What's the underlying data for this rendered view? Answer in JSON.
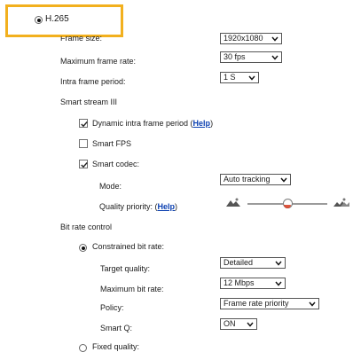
{
  "codec": {
    "h265_label": "H.265",
    "frame_size_label": "Frame size:",
    "frame_size_value": "1920x1080",
    "max_frame_rate_label": "Maximum frame rate:",
    "max_frame_rate_value": "30 fps",
    "intra_frame_period_label": "Intra frame period:",
    "intra_frame_period_value": "1 S"
  },
  "smart_stream": {
    "title": "Smart stream III",
    "dynamic_intra_label": "Dynamic intra frame period (",
    "dynamic_intra_help": "Help",
    "dynamic_intra_close": ")",
    "smart_fps_label": "Smart FPS",
    "smart_codec_label": "Smart codec:",
    "mode_label": "Mode:",
    "mode_value": "Auto tracking",
    "quality_priority_label": "Quality priority: (",
    "quality_priority_help": "Help",
    "quality_priority_close": ")",
    "quality_priority_level": 0.5
  },
  "bit_rate_control": {
    "title": "Bit rate control",
    "constrained_label": "Constrained bit rate:",
    "target_quality_label": "Target quality:",
    "target_quality_value": "Detailed",
    "max_bit_rate_label": "Maximum bit rate:",
    "max_bit_rate_value": "12 Mbps",
    "policy_label": "Policy:",
    "policy_value": "Frame rate priority",
    "smart_q_label": "Smart Q:",
    "smart_q_value": "ON",
    "fixed_quality_label": "Fixed quality:"
  },
  "colors": {
    "highlight": "#f2b01e",
    "link": "#0a3fb0",
    "slider_knob_accent": "#d83a1f"
  }
}
